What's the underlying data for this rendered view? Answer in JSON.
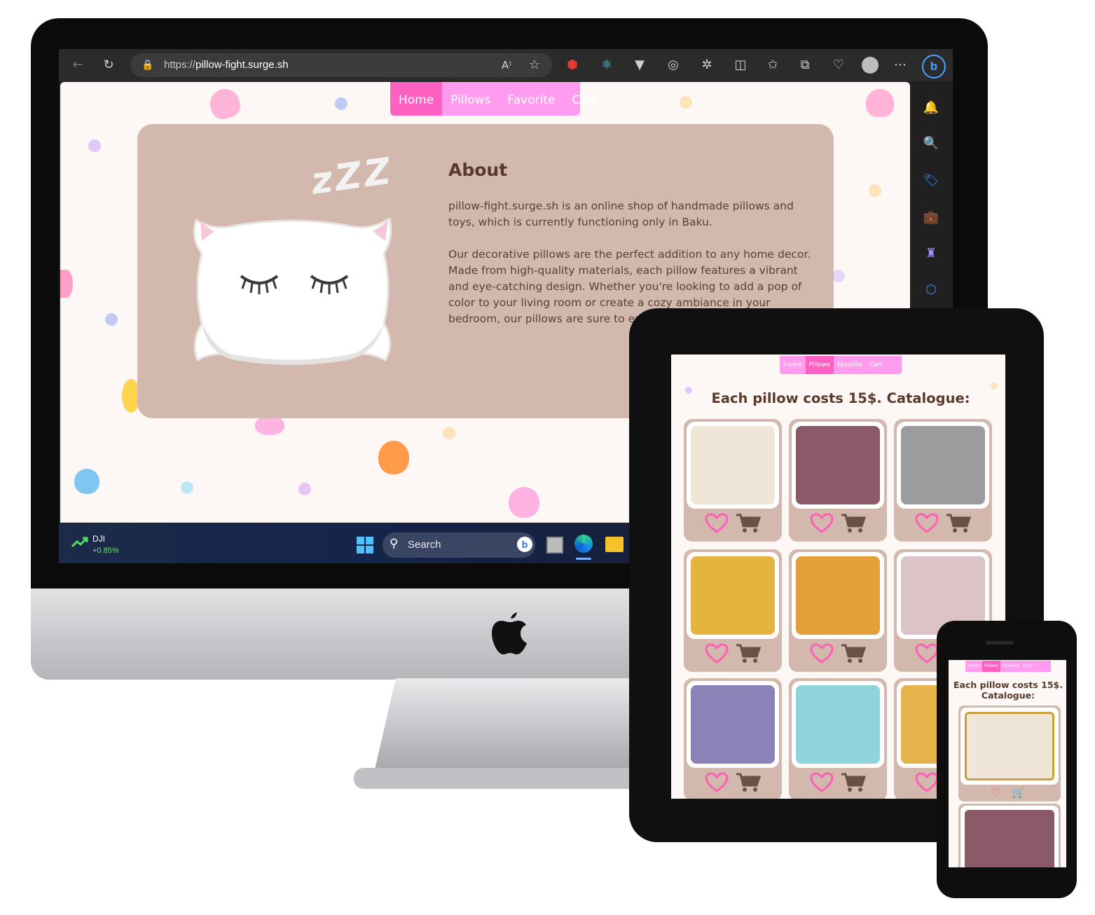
{
  "browser": {
    "url_prefix": "https://",
    "url_host": "pillow-fight.surge.sh",
    "read_aloud_label": "A⁾"
  },
  "site": {
    "nav": [
      "Home",
      "Pillows",
      "Favorite",
      "Cart"
    ],
    "active_nav_desktop": "Home",
    "active_nav_tablet": "Pillows",
    "about_title": "About",
    "about_paragraph_1": "pillow-fight.surge.sh is an online shop of handmade pillows and toys, which is currently functioning only in Baku.",
    "about_paragraph_2": "Our decorative pillows are the perfect addition to any home decor. Made from high-quality materials, each pillow features a vibrant and eye-catching design. Whether you're looking to add a pop of color to your living room or create a cozy ambiance in your bedroom, our pillows are sure to enhance any space",
    "zzz": "zZZ",
    "catalogue_title": "Each pillow costs 15$. Catalogue:",
    "catalogue_title_phone_line1": "Each pillow costs 15$.",
    "catalogue_title_phone_line2": "Catalogue:"
  },
  "taskbar": {
    "ticker": "DJI",
    "ticker_change": "+0.85%",
    "search_placeholder": "Search"
  },
  "colors": {
    "nav_bg": "#ff9cf0",
    "nav_active": "#ff61c2",
    "card_bg": "#d2b8ad",
    "page_bg": "#fdf8f5",
    "heart_icon": "#ff5fb7",
    "cart_icon": "#6a5045"
  },
  "catalogue": [
    {
      "name": "lace-pillow",
      "color": "#efe6d8"
    },
    {
      "name": "bird-pillow",
      "color": "#8a5a68"
    },
    {
      "name": "cactus-grey-pillow",
      "color": "#9c9c9e"
    },
    {
      "name": "cactus-yellow-pillow",
      "color": "#e4b43f"
    },
    {
      "name": "cactus-orange-pillow",
      "color": "#e39f3a"
    },
    {
      "name": "hearts-pink-pillow",
      "color": "#dcc3c8"
    },
    {
      "name": "hearts-purple-pillow",
      "color": "#8d82b8"
    },
    {
      "name": "mandala-blue-pillow",
      "color": "#8fd3dd"
    },
    {
      "name": "mandala-yellow-pillow",
      "color": "#e6b24a"
    }
  ]
}
